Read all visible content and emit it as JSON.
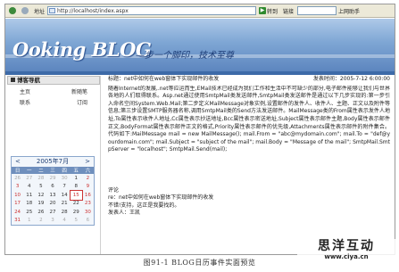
{
  "browser": {
    "address_label": "地址",
    "url": "http://localhost/index.aspx",
    "go_label": "转到",
    "links_label": "链接",
    "search_label": "上网助手"
  },
  "banner": {
    "logo": "Ooking BLOG",
    "slogan": "—步一个脚印，技术至尊"
  },
  "sidebar": {
    "header": "博客导航",
    "rows": [
      {
        "left": "主页",
        "right": "新随笔"
      },
      {
        "left": "联系",
        "right": "订阅"
      }
    ],
    "calendar": {
      "title": "2005年7月",
      "prev": "<",
      "next": ">",
      "weekdays": [
        "日",
        "一",
        "二",
        "三",
        "四",
        "五",
        "六"
      ],
      "weeks": [
        [
          "26",
          "27",
          "28",
          "29",
          "30",
          "1",
          "2"
        ],
        [
          "3",
          "4",
          "5",
          "6",
          "7",
          "8",
          "9"
        ],
        [
          "10",
          "11",
          "12",
          "13",
          "14",
          "15",
          "16"
        ],
        [
          "17",
          "18",
          "19",
          "20",
          "21",
          "22",
          "23"
        ],
        [
          "24",
          "25",
          "26",
          "27",
          "28",
          "29",
          "30"
        ],
        [
          "31",
          "1",
          "2",
          "3",
          "4",
          "5",
          "6"
        ]
      ],
      "today": "15"
    }
  },
  "post": {
    "title": "标题：net中如何在web窗体下实现邮件的收发",
    "meta": "发表时间：2005-7-12 6:00:00",
    "body": "随着Internet的发展,.net等应运而生,EMail技术已经成为我们工作和生活中不可缺少的部分,电子邮件能够让我们与世界各地的人们取得联系。Asp.net通过使用SmtpMail类发送邮件,SmtpMail类发送邮件是通过以下几步实现的:第一步引入命名空间System.Web.Mail;第二步定义MailMessage对象实例,设置邮件的发件人、收件人、主题、正文以及附件等信息;第三步设置SMTP服务器名称,调用SmtpMail类的Send方法发送邮件。MailMessage类的From属性表示发件人地址,To属性表示收件人地址,Cc属性表示抄送地址,Bcc属性表示密送地址,Subject属性表示邮件主题,Body属性表示邮件正文,BodyFormat属性表示邮件正文的格式,Priority属性表示邮件的优先级,Attachments属性表示邮件的附件集合。代码如下:MailMessage mail = new MailMessage(); mail.From = \"abc@mydomain.com\"; mail.To = \"def@yourdomain.com\"; mail.Subject = \"subject of the mail\"; mail.Body = \"Message of the mail\"; SmtpMail.SmtpServer = \"localhost\"; SmtpMail.Send(mail);",
    "comments_label": "评论",
    "comments": [
      "re：net中如何在web窗体下实现邮件的收发",
      "不错!支持，这正是我要找的。",
      "发表人：王凯"
    ]
  },
  "caption": "图91-1  BLOG日历事件实面预览",
  "watermark": {
    "big": "思洋互动",
    "small": "www.ciya.cn"
  }
}
